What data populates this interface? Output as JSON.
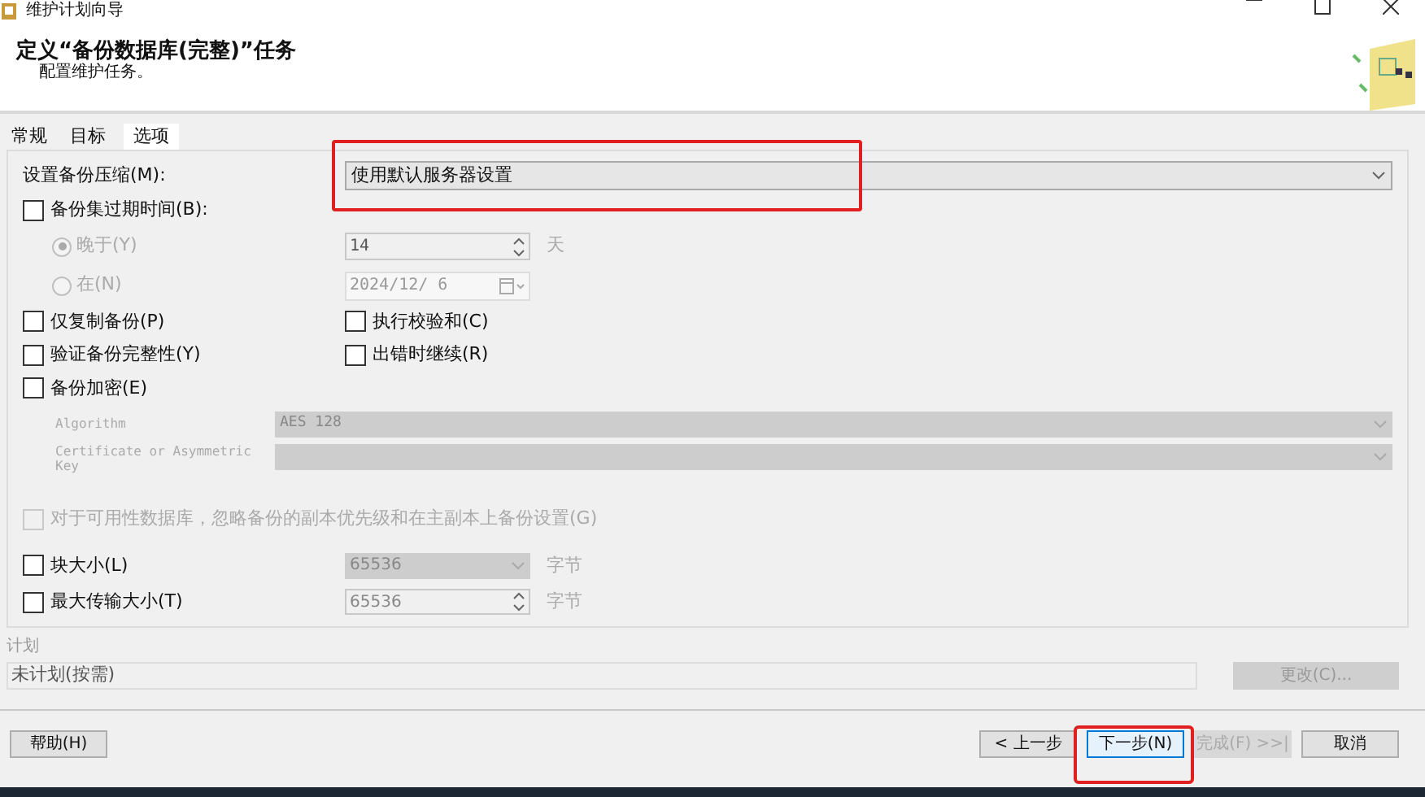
{
  "window": {
    "title": "维护计划向导"
  },
  "header": {
    "title": "定义“备份数据库(完整)”任务",
    "subtitle": "配置维护任务。"
  },
  "tabs": [
    {
      "label": "常规",
      "selected": false
    },
    {
      "label": "目标",
      "selected": false
    },
    {
      "label": "选项",
      "selected": true
    }
  ],
  "compression": {
    "label": "设置备份压缩(M):",
    "value": "使用默认服务器设置"
  },
  "expiry": {
    "label": "备份集过期时间(B):",
    "checked": false,
    "options": [
      {
        "label": "晚于(Y)",
        "selected": true,
        "kind": "spin",
        "value": "14",
        "unit": "天"
      },
      {
        "label": "在(N)",
        "selected": false,
        "kind": "date",
        "value": "2024/12/ 6"
      }
    ]
  },
  "options": [
    {
      "label": "仅复制备份(P)",
      "checked": false
    },
    {
      "label": "执行校验和(C)",
      "checked": false
    },
    {
      "label": "验证备份完整性(Y)",
      "checked": false
    },
    {
      "label": "出错时继续(R)",
      "checked": false
    }
  ],
  "encryption": {
    "label": "备份加密(E)",
    "checked": false,
    "algorithm_label": "Algorithm",
    "algorithm": "AES 128",
    "key_label": "Certificate or Asymmetric Key"
  },
  "availability": {
    "label": "对于可用性数据库，忽略备份的副本优先级和在主副本上备份设置(G)",
    "checked": false,
    "disabled": true
  },
  "sizes": [
    {
      "label": "块大小(L)",
      "checked": false,
      "kind": "dropdown",
      "value": "65536",
      "unit": "字节"
    },
    {
      "label": "最大传输大小(T)",
      "checked": false,
      "kind": "spin",
      "value": "65536",
      "unit": "字节"
    }
  ],
  "schedule": {
    "label": "计划",
    "value": "未计划(按需)",
    "button": "更改(C)...",
    "disabled": true
  },
  "buttons": [
    {
      "label": "帮助(H)",
      "kind": "left",
      "disabled": false
    },
    {
      "label": "< 上一步",
      "kind": "right",
      "disabled": false
    },
    {
      "label": "下一步(N)",
      "kind": "right",
      "disabled": false,
      "focused": true
    },
    {
      "label": "完成(F) >>|",
      "kind": "right",
      "disabled": true
    },
    {
      "label": "取消",
      "kind": "right",
      "disabled": false
    }
  ]
}
